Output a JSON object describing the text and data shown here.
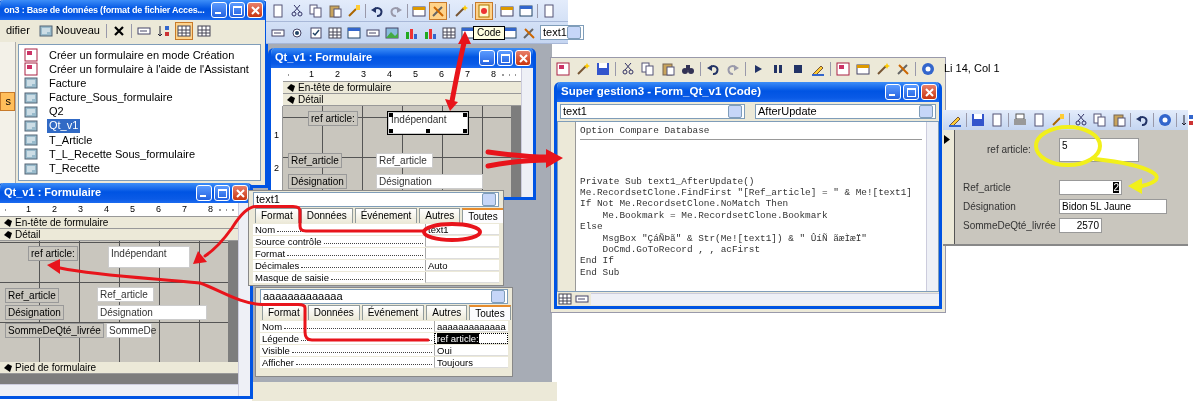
{
  "database_window": {
    "title": "on3 : Base de données (format de fichier Acces...",
    "toolbar": [
      {
        "label": "difier"
      },
      {
        "label": "Nouveau"
      }
    ],
    "nav": [
      {
        "label": "s",
        "selected": true
      }
    ],
    "objects": [
      {
        "kind": "action",
        "label": "Créer un formulaire en mode Création",
        "selected": false
      },
      {
        "kind": "action",
        "label": "Créer un formulaire à l'aide de l'Assistant",
        "selected": false
      },
      {
        "kind": "form",
        "label": "Facture",
        "selected": false
      },
      {
        "kind": "form",
        "label": "Facture_Sous_formulaire",
        "selected": false
      },
      {
        "kind": "form",
        "label": "Q2",
        "selected": false
      },
      {
        "kind": "form",
        "label": "Qt_v1",
        "selected": true
      },
      {
        "kind": "form",
        "label": "T_Article",
        "selected": false
      },
      {
        "kind": "form",
        "label": "T_L_Recette Sous_formulaire",
        "selected": false
      },
      {
        "kind": "form",
        "label": "T_Recette",
        "selected": false
      }
    ]
  },
  "design_toolbar": {
    "tooltip": "Code",
    "object_combo": "text1"
  },
  "form_designers": [
    {
      "title": "Qt_v1 : Formulaire",
      "ruler": [
        "1",
        "2",
        "3",
        "4",
        "5",
        "6",
        "7",
        "8"
      ],
      "vertical_ruler": [
        "1",
        "2"
      ],
      "sections": [
        {
          "label": "En-tête de formulaire"
        },
        {
          "label": "Détail"
        }
      ],
      "controls": [
        {
          "kind": "label",
          "text": "ref article:",
          "selected": false
        },
        {
          "kind": "textbox",
          "text": "Indépendant",
          "selected": true
        },
        {
          "kind": "label",
          "text": "Ref_article",
          "selected": false
        },
        {
          "kind": "textbox",
          "text": "Ref_article",
          "selected": false
        },
        {
          "kind": "label",
          "text": "Désignation",
          "selected": false
        },
        {
          "kind": "textbox",
          "text": "Désignation",
          "selected": false
        }
      ]
    },
    {
      "title": "Qt_v1 : Formulaire",
      "ruler": [
        "1",
        "2",
        "3",
        "4",
        "5",
        "6",
        "7",
        "8"
      ],
      "sections": [
        {
          "label": "En-tête de formulaire"
        },
        {
          "label": "Détail"
        }
      ],
      "controls": [
        {
          "kind": "label",
          "text": "ref article:",
          "selected": false
        },
        {
          "kind": "textbox",
          "text": "Indépendant",
          "selected": false
        },
        {
          "kind": "label",
          "text": "Ref_article",
          "selected": false
        },
        {
          "kind": "textbox",
          "text": "Ref_article",
          "selected": false
        },
        {
          "kind": "label",
          "text": "Désignation",
          "selected": false
        },
        {
          "kind": "textbox",
          "text": "Désignation",
          "selected": false
        },
        {
          "kind": "label",
          "text": "SommeDeQté_livrée",
          "selected": false
        },
        {
          "kind": "textbox",
          "text": "SommeDe",
          "selected": false
        }
      ],
      "footer": "Pied de formulaire"
    }
  ],
  "property_sheets": [
    {
      "object": "text1",
      "tabs": [
        {
          "label": "Format",
          "selected": false
        },
        {
          "label": "Données",
          "selected": false
        },
        {
          "label": "Événement",
          "selected": false
        },
        {
          "label": "Autres",
          "selected": false
        },
        {
          "label": "Toutes",
          "selected": true
        }
      ],
      "rows": [
        {
          "name": "Nom",
          "value": "text1",
          "selected": false
        },
        {
          "name": "Source contrôle",
          "selected": false
        },
        {
          "name": "Format",
          "selected": false
        },
        {
          "name": "Décimales",
          "value": "Auto",
          "selected": false
        },
        {
          "name": "Masque de saisie",
          "selected": false
        }
      ]
    },
    {
      "object": "aaaaaaaaaaaaa",
      "tabs": [
        {
          "label": "Format",
          "selected": false
        },
        {
          "label": "Données",
          "selected": false
        },
        {
          "label": "Événement",
          "selected": false
        },
        {
          "label": "Autres",
          "selected": false
        },
        {
          "label": "Toutes",
          "selected": true
        }
      ],
      "rows": [
        {
          "name": "Nom",
          "value": "aaaaaaaaaaaaa",
          "selected": false
        },
        {
          "name": "Légende",
          "value": "ref article:",
          "selected": true
        },
        {
          "name": "Visible",
          "value": "Oui",
          "selected": false
        },
        {
          "name": "Afficher",
          "value": "Toujours",
          "selected": false
        }
      ]
    }
  ],
  "code_window": {
    "status": "Li 14, Col 1",
    "title": "Super gestion3 - Form_Qt_v1 (Code)",
    "object": "text1",
    "procedure_name": "AfterUpdate",
    "declarations": [
      "Option Compare Database"
    ],
    "procedure": [
      "Private Sub text1_AfterUpdate()",
      "Me.RecordsetClone.FindFirst \"[Ref_article] = \" & Me![text1]",
      "If Not Me.RecordsetClone.NoMatch Then",
      "    Me.Bookmark = Me.RecordsetClone.Bookmark",
      "Else",
      "    MsgBox \"ÇáÑÞã\" & Str(Me![text1]) & \" ÛíÑ ãæÌæÏ\"",
      "    DoCmd.GoToRecord , , acFirst",
      "End If",
      "End Sub"
    ]
  },
  "form_view": {
    "controls": [
      {
        "label": "ref article:",
        "value": "5",
        "selected": false
      },
      {
        "label": "Ref_article",
        "value": "2",
        "selected": true
      },
      {
        "label": "Désignation",
        "value": "Bidon 5L Jaune",
        "selected": false
      },
      {
        "label": "SommeDeQté_livrée",
        "value": "2570",
        "selected": false
      }
    ]
  }
}
